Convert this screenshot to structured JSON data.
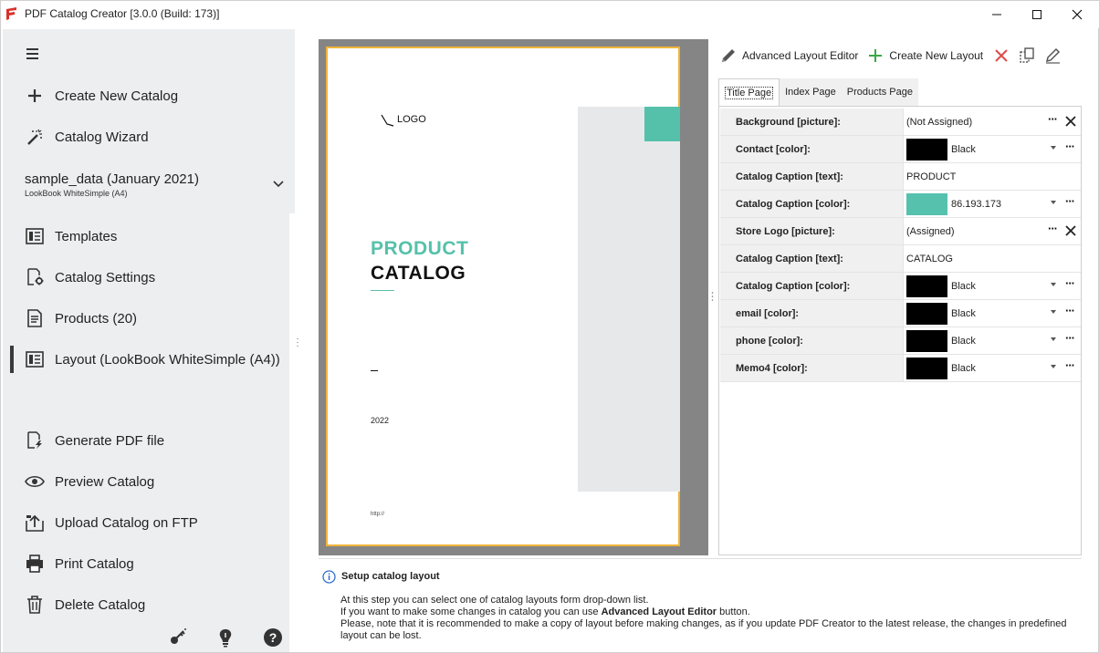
{
  "window": {
    "title": "PDF Catalog Creator [3.0.0 (Build: 173)]"
  },
  "sidebar": {
    "create_new": "Create New Catalog",
    "wizard": "Catalog Wizard",
    "project": {
      "name": "sample_data (January 2021)",
      "layout": "LookBook WhiteSimple (A4)"
    },
    "items": [
      {
        "label": "Templates",
        "icon": "templates-icon"
      },
      {
        "label": "Catalog Settings",
        "icon": "settings-doc-icon"
      },
      {
        "label": "Products (20)",
        "icon": "products-icon"
      },
      {
        "label": "Layout (LookBook WhiteSimple (A4))",
        "icon": "layout-icon"
      }
    ],
    "actions": [
      {
        "label": "Generate PDF file",
        "icon": "generate-pdf-icon"
      },
      {
        "label": "Preview Catalog",
        "icon": "eye-icon"
      },
      {
        "label": "Upload Catalog on FTP",
        "icon": "upload-icon"
      },
      {
        "label": "Print Catalog",
        "icon": "printer-icon"
      },
      {
        "label": "Delete Catalog",
        "icon": "trash-icon"
      }
    ]
  },
  "preview": {
    "logo": "LOGO",
    "caption1": "PRODUCT",
    "caption2": "CATALOG",
    "year": "2022",
    "url": "http://",
    "colors": {
      "accent": "#56c1ab",
      "page_border": "#f0b43a",
      "grey_block": "#e7e8e9"
    }
  },
  "toolbar": {
    "advanced_editor": "Advanced Layout Editor",
    "create_layout": "Create New Layout"
  },
  "tabs": [
    "Title Page",
    "Index Page",
    "Products Page"
  ],
  "properties": [
    {
      "label": "Background [picture]:",
      "value": "(Not Assigned)",
      "kind": "picture"
    },
    {
      "label": "Contact [color]:",
      "value": "Black",
      "kind": "color",
      "color": "#000000"
    },
    {
      "label": "Catalog Caption [text]:",
      "value": "PRODUCT",
      "kind": "text"
    },
    {
      "label": "Catalog Caption [color]:",
      "value": "86.193.173",
      "kind": "color",
      "color": "#56c1ad"
    },
    {
      "label": "Store Logo [picture]:",
      "value": "(Assigned)",
      "kind": "picture"
    },
    {
      "label": "Catalog Caption [text]:",
      "value": "CATALOG",
      "kind": "text"
    },
    {
      "label": "Catalog Caption [color]:",
      "value": "Black",
      "kind": "color",
      "color": "#000000"
    },
    {
      "label": "email [color]:",
      "value": "Black",
      "kind": "color",
      "color": "#000000"
    },
    {
      "label": "phone [color]:",
      "value": "Black",
      "kind": "color",
      "color": "#000000"
    },
    {
      "label": "Memo4 [color]:",
      "value": "Black",
      "kind": "color",
      "color": "#000000"
    }
  ],
  "info": {
    "title": "Setup catalog layout",
    "line1": "At this step you can select one of catalog layouts form drop-down list.",
    "line2_pre": "If you want to make some changes in catalog you can use ",
    "line2_bold": "Advanced Layout Editor",
    "line2_post": " button.",
    "line3": "Please, note that it is recommended to make a copy of layout before making changes, as if you update PDF Creator to the latest release, the changes in predefined",
    "line4": "layout can be lost."
  }
}
